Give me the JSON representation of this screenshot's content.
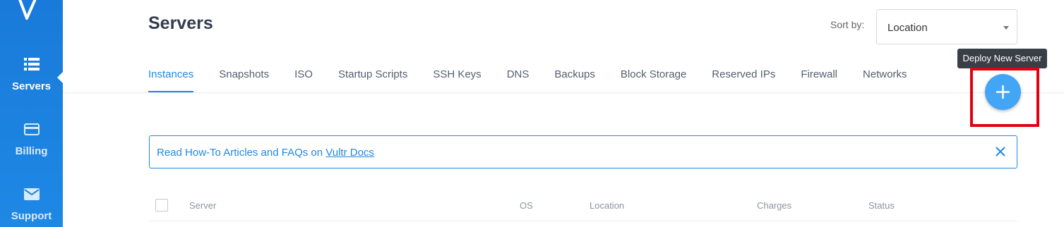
{
  "sidebar": {
    "logo_icon": "vultr-v-logo",
    "items": [
      {
        "label": "Servers",
        "icon": "server-list-icon",
        "active": true
      },
      {
        "label": "Billing",
        "icon": "credit-card-icon",
        "active": false
      },
      {
        "label": "Support",
        "icon": "envelope-icon",
        "active": false
      }
    ]
  },
  "header": {
    "title": "Servers",
    "sort_label": "Sort by:",
    "sort_value": "Location"
  },
  "tabs": [
    {
      "label": "Instances",
      "active": true
    },
    {
      "label": "Snapshots"
    },
    {
      "label": "ISO"
    },
    {
      "label": "Startup Scripts"
    },
    {
      "label": "SSH Keys"
    },
    {
      "label": "DNS"
    },
    {
      "label": "Backups"
    },
    {
      "label": "Block Storage"
    },
    {
      "label": "Reserved IPs"
    },
    {
      "label": "Firewall"
    },
    {
      "label": "Networks"
    }
  ],
  "deploy": {
    "tooltip": "Deploy New Server",
    "icon": "plus-icon"
  },
  "banner": {
    "text": "Read How-To Articles and FAQs on ",
    "link": "Vultr Docs",
    "close_icon": "close-icon"
  },
  "table": {
    "columns": [
      "Server",
      "OS",
      "Location",
      "Charges",
      "Status"
    ]
  },
  "colors": {
    "brand": "#1e88e5",
    "fab": "#42a5f5",
    "highlight": "#e0000f"
  }
}
